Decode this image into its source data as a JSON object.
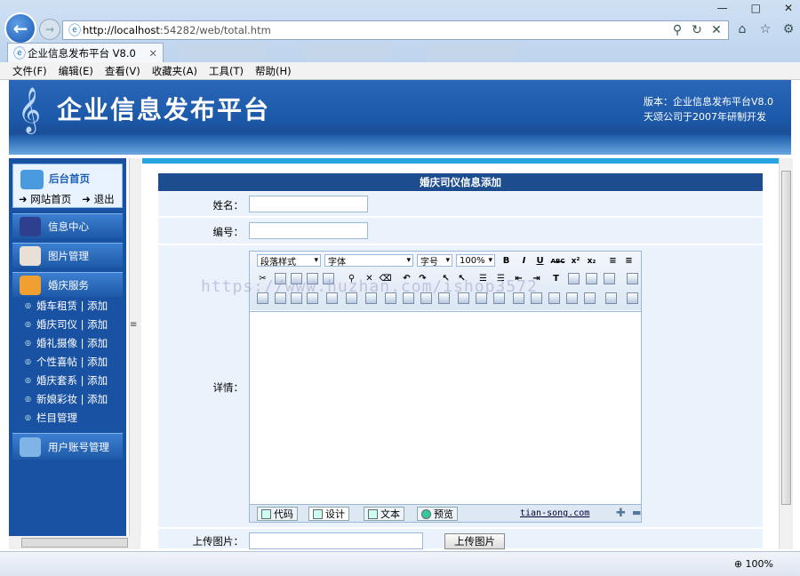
{
  "browser": {
    "url_host": "http://localhost",
    "url_rest": ":54282/web/total.htm",
    "tab_title": "企业信息发布平台 V8.0",
    "menu": [
      "文件(F)",
      "编辑(E)",
      "查看(V)",
      "收藏夹(A)",
      "工具(T)",
      "帮助(H)"
    ],
    "window_controls": [
      "—",
      "□",
      "✕"
    ],
    "zoom": "100%"
  },
  "header": {
    "title": "企业信息发布平台",
    "version_line": "版本：企业信息发布平台V8.0",
    "company_line": "天颂公司于2007年研制开发"
  },
  "sidebar": {
    "home": "后台首页",
    "site_home": "网站首页",
    "logout": "退出",
    "sections": [
      "信息中心",
      "图片管理",
      "婚庆服务"
    ],
    "items": [
      {
        "label": "婚车租赁 | 添加"
      },
      {
        "label": "婚庆司仪 | 添加"
      },
      {
        "label": "婚礼摄像 | 添加"
      },
      {
        "label": "个性喜帖 | 添加"
      },
      {
        "label": "婚庆套系 | 添加"
      },
      {
        "label": "新娘彩妆 | 添加"
      },
      {
        "label": "栏目管理"
      }
    ],
    "account": "用户账号管理"
  },
  "form": {
    "title": "婚庆司仪信息添加",
    "name_label": "姓名：",
    "code_label": "编号：",
    "detail_label": "详情：",
    "upload_label": "上传图片：",
    "upload_button": "上传图片"
  },
  "editor": {
    "paragraph_style": "段落样式",
    "font": "字体",
    "font_size": "字号",
    "zoom": "100%",
    "modes": [
      "代码",
      "设计",
      "文本",
      "预览"
    ],
    "credit": "tian-song.com"
  },
  "watermark": "https://www.huzhan.com/ishop3572"
}
